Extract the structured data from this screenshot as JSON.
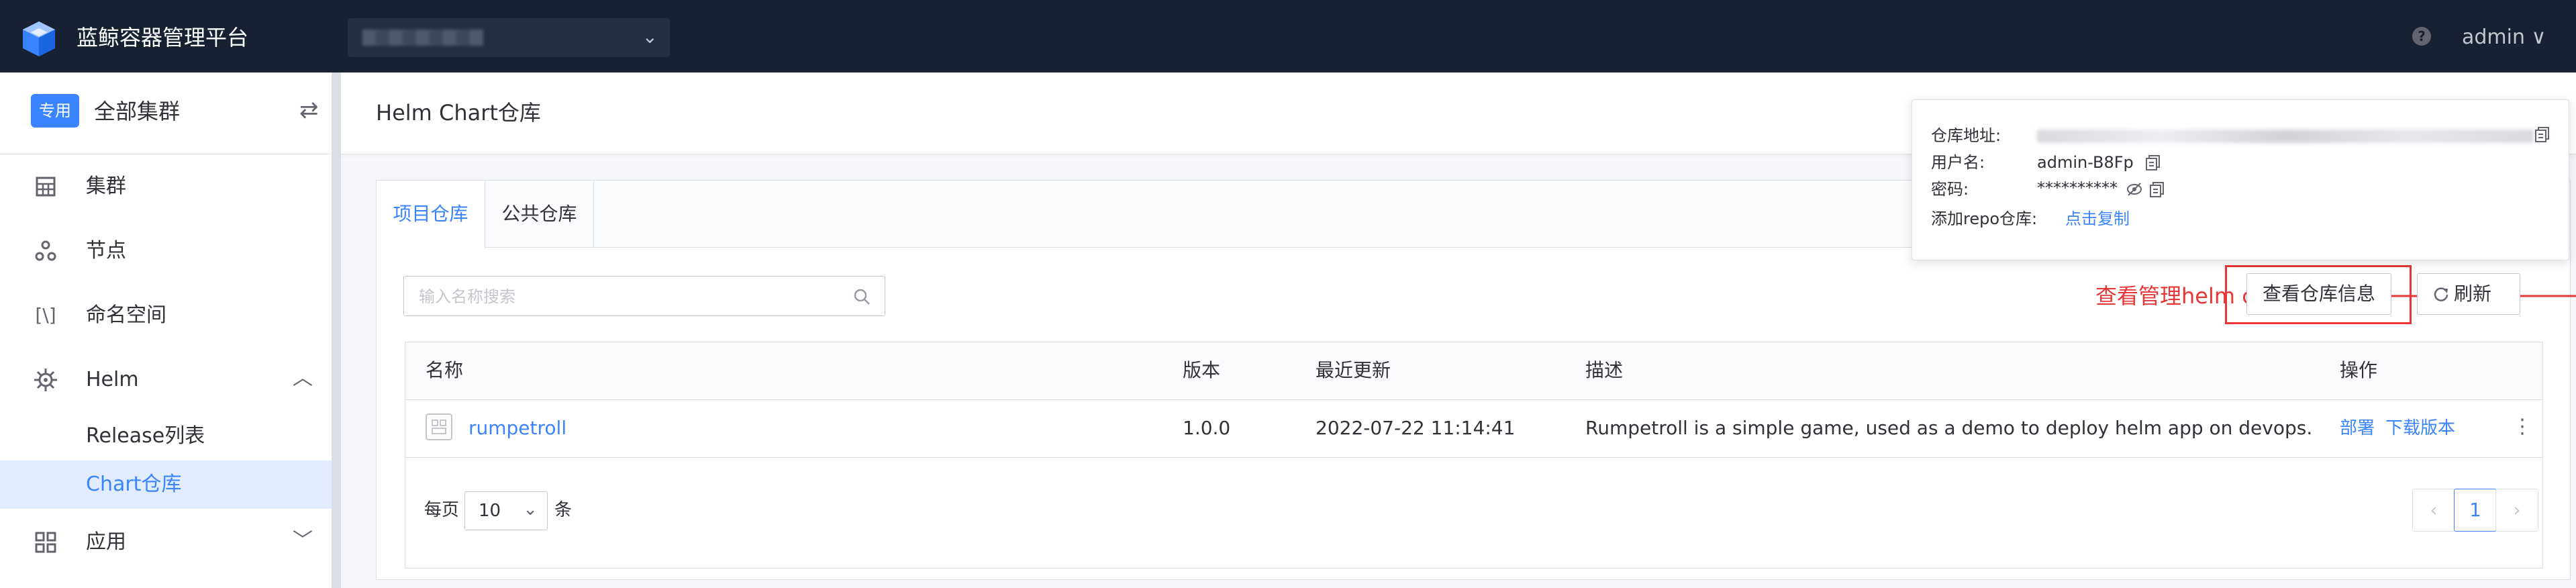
{
  "topbar": {
    "app_title": "蓝鲸容器管理平台",
    "user": "admin ∨",
    "help_icon": "?"
  },
  "sidebar": {
    "cluster_badge": "专用",
    "cluster_name": "全部集群",
    "items": [
      {
        "label": "集群",
        "icon": "grid-icon"
      },
      {
        "label": "节点",
        "icon": "nodes-icon"
      },
      {
        "label": "命名空间",
        "icon": "brackets-icon"
      },
      {
        "label": "Helm",
        "icon": "helm-icon"
      },
      {
        "label": "应用",
        "icon": "apps-icon"
      }
    ],
    "helm_sub": [
      {
        "label": "Release列表"
      },
      {
        "label": "Chart仓库"
      }
    ]
  },
  "page": {
    "title": "Helm Chart仓库"
  },
  "tabs": [
    {
      "label": "项目仓库",
      "active": true
    },
    {
      "label": "公共仓库",
      "active": false
    }
  ],
  "search": {
    "placeholder": "输入名称搜索"
  },
  "annotation": "查看管理helm chart所需信息",
  "buttons": {
    "repo_info": "查看仓库信息",
    "refresh": "刷新"
  },
  "table": {
    "columns": [
      "名称",
      "版本",
      "最近更新",
      "描述",
      "操作"
    ],
    "rows": [
      {
        "name": "rumpetroll",
        "version": "1.0.0",
        "updated": "2022-07-22 11:14:41",
        "description": "Rumpetroll is a simple game, used as a demo to deploy helm app on devops.",
        "actions": [
          "部署",
          "下载版本"
        ]
      }
    ]
  },
  "pagination": {
    "per_page_label": "每页",
    "per_page_value": "10",
    "unit": "条",
    "current_page": "1"
  },
  "popover": {
    "repo_addr_label": "仓库地址:",
    "username_label": "用户名:",
    "username_value": "admin-B8Fp",
    "password_label": "密码:",
    "password_value": "**********",
    "add_repo_label": "添加repo仓库:",
    "add_repo_link": "点击复制"
  },
  "colors": {
    "topbar_bg": "#182132",
    "primary": "#3a84ff",
    "annotation_red": "#ea3636"
  }
}
